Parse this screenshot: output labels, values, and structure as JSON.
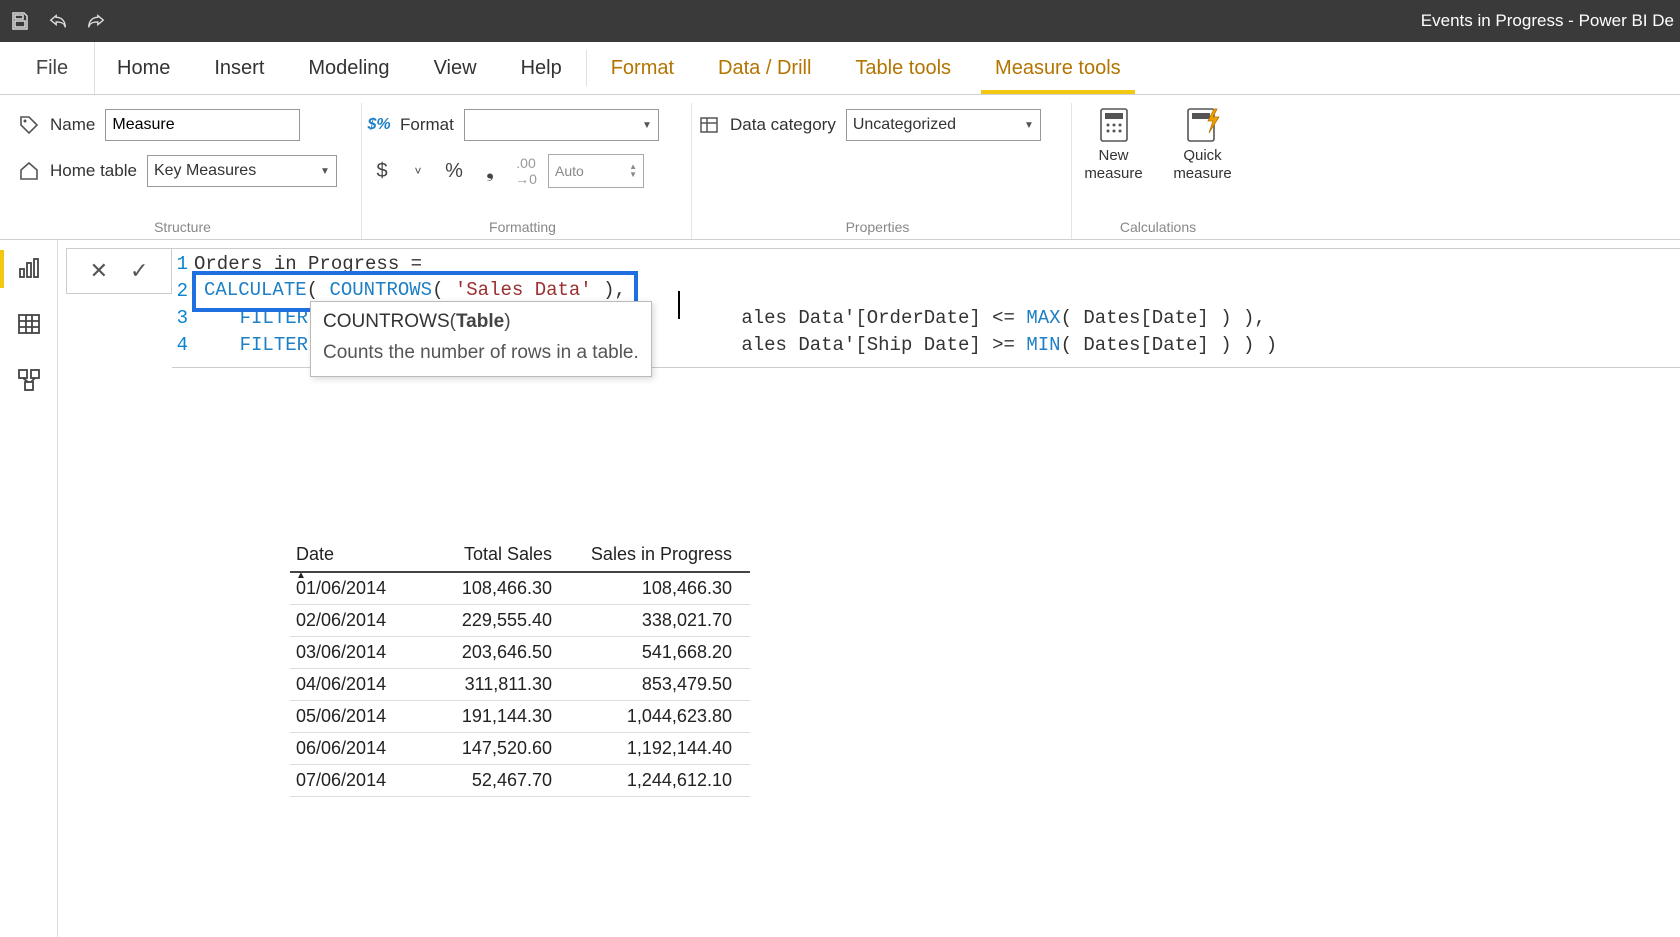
{
  "titlebar": {
    "title": "Events in Progress - Power BI De"
  },
  "tabs": {
    "file": "File",
    "items": [
      {
        "label": "Home",
        "contextual": false,
        "active": false
      },
      {
        "label": "Insert",
        "contextual": false,
        "active": false
      },
      {
        "label": "Modeling",
        "contextual": false,
        "active": false
      },
      {
        "label": "View",
        "contextual": false,
        "active": false
      },
      {
        "label": "Help",
        "contextual": false,
        "active": false
      },
      {
        "label": "Format",
        "contextual": true,
        "active": false
      },
      {
        "label": "Data / Drill",
        "contextual": true,
        "active": false
      },
      {
        "label": "Table tools",
        "contextual": true,
        "active": false
      },
      {
        "label": "Measure tools",
        "contextual": true,
        "active": true
      }
    ]
  },
  "ribbon": {
    "structure": {
      "name_label": "Name",
      "name_value": "Measure",
      "home_table_label": "Home table",
      "home_table_value": "Key Measures",
      "group_label": "Structure"
    },
    "formatting": {
      "format_label": "Format",
      "format_value": "",
      "decimals_placeholder": "Auto",
      "group_label": "Formatting"
    },
    "properties": {
      "data_category_label": "Data category",
      "data_category_value": "Uncategorized",
      "group_label": "Properties"
    },
    "calculations": {
      "new_measure_label": "New\nmeasure",
      "quick_measure_label": "Quick\nmeasure",
      "group_label": "Calculations"
    }
  },
  "formula": {
    "line1": "Orders in Progress =",
    "highlight_calc": "CALCULATE",
    "highlight_countrows": "COUNTROWS",
    "highlight_arg": "'Sales Data'",
    "highlight_tail": " ),",
    "line3": {
      "filter": "FILTER(",
      "rest_a": "ales Data'[OrderDate] <= ",
      "max": "MAX",
      "rest_b": "( Dates[Date] ) ),"
    },
    "line4": {
      "filter": "FILTER(",
      "rest_a": "ales Data'[Ship Date] >= ",
      "min": "MIN",
      "rest_b": "( Dates[Date] ) ) )"
    },
    "tooltip": {
      "sig_fn": "COUNTROWS",
      "sig_open": "(",
      "sig_arg": "Table",
      "sig_close": ")",
      "desc": "Counts the number of rows in a table."
    },
    "line_numbers": [
      "1",
      "2",
      "3",
      "4"
    ]
  },
  "table": {
    "columns": [
      "Date",
      "Total Sales",
      "Sales in Progress"
    ],
    "rows": [
      {
        "date": "01/06/2014",
        "total": "108,466.30",
        "prog": "108,466.30"
      },
      {
        "date": "02/06/2014",
        "total": "229,555.40",
        "prog": "338,021.70"
      },
      {
        "date": "03/06/2014",
        "total": "203,646.50",
        "prog": "541,668.20"
      },
      {
        "date": "04/06/2014",
        "total": "311,811.30",
        "prog": "853,479.50"
      },
      {
        "date": "05/06/2014",
        "total": "191,144.30",
        "prog": "1,044,623.80"
      },
      {
        "date": "06/06/2014",
        "total": "147,520.60",
        "prog": "1,192,144.40"
      },
      {
        "date": "07/06/2014",
        "total": "52,467.70",
        "prog": "1,244,612.10"
      }
    ]
  }
}
